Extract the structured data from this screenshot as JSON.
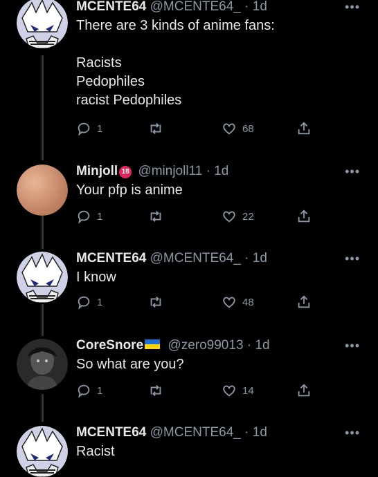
{
  "tweets": [
    {
      "name": "MCENTE64",
      "handle": "@MCENTE64_",
      "time": "· 1d",
      "lines": [
        "There are 3 kinds of anime fans:",
        "",
        "Racists",
        "Pedophiles",
        "racist Pedophiles"
      ],
      "replies": "1",
      "likes": "68"
    },
    {
      "name": "Minjoll",
      "badge": "18",
      "handle": "@minjoll11",
      "time": "· 1d",
      "lines": [
        "Your pfp is anime"
      ],
      "replies": "1",
      "likes": "22"
    },
    {
      "name": "MCENTE64",
      "handle": "@MCENTE64_",
      "time": "· 1d",
      "lines": [
        "I know"
      ],
      "replies": "1",
      "likes": "48"
    },
    {
      "name": "CoreSnore",
      "handle": "@zero99013",
      "time": "· 1d",
      "lines": [
        "So what are you?"
      ],
      "replies": "1",
      "likes": "14"
    },
    {
      "name": "MCENTE64",
      "handle": "@MCENTE64_",
      "time": "· 1d",
      "lines": [
        "Racist"
      ]
    }
  ],
  "more_label": "•••",
  "icons": {
    "reply": "reply-icon",
    "retweet": "retweet-icon",
    "like": "heart-icon",
    "share": "share-icon",
    "more": "more-icon"
  },
  "colors": {
    "background": "#000000",
    "text": "#e7e9ea",
    "muted": "#8b98a5",
    "badge": "#e0245e"
  }
}
